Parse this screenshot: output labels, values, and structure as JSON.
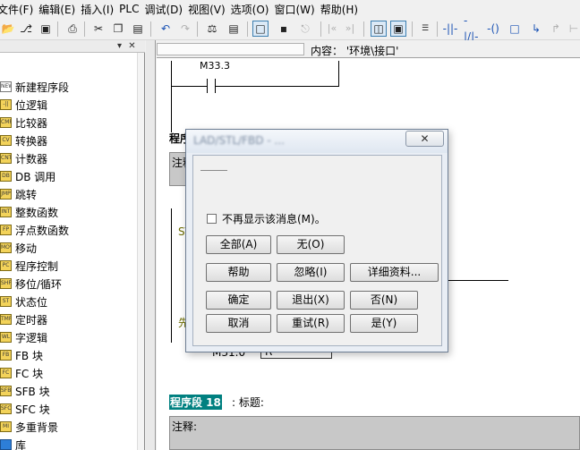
{
  "menubar": {
    "items": [
      "文件(F)",
      "编辑(E)",
      "插入(I)",
      "PLC",
      "调试(D)",
      "视图(V)",
      "选项(O)",
      "窗口(W)",
      "帮助(H)"
    ]
  },
  "toolbar": {
    "icons": [
      "open-folder-icon",
      "save-icon",
      "print-icon",
      "cut-icon",
      "copy-icon",
      "paste-icon",
      "undo-icon",
      "redo-icon",
      "monitor-icon",
      "zoom-icon",
      "normally-open-contact-icon",
      "normally-closed-contact-icon",
      "coil-icon"
    ]
  },
  "left_panel": {
    "items": [
      {
        "label": "新建程序段",
        "icon": "new-network-icon"
      },
      {
        "label": "位逻辑",
        "icon": "bit-logic-icon"
      },
      {
        "label": "比较器",
        "icon": "comparator-icon"
      },
      {
        "label": "转换器",
        "icon": "converter-icon"
      },
      {
        "label": "计数器",
        "icon": "counter-icon"
      },
      {
        "label": "DB 调用",
        "icon": "db-call-icon"
      },
      {
        "label": "跳转",
        "icon": "jump-icon"
      },
      {
        "label": "整数函数",
        "icon": "integer-function-icon"
      },
      {
        "label": "浮点数函数",
        "icon": "float-function-icon"
      },
      {
        "label": "移动",
        "icon": "move-icon"
      },
      {
        "label": "程序控制",
        "icon": "program-control-icon"
      },
      {
        "label": "移位/循环",
        "icon": "shift-rotate-icon"
      },
      {
        "label": "状态位",
        "icon": "status-bit-icon"
      },
      {
        "label": "定时器",
        "icon": "timer-icon"
      },
      {
        "label": "字逻辑",
        "icon": "word-logic-icon"
      },
      {
        "label": "FB 块",
        "icon": "fb-block-icon"
      },
      {
        "label": "FC 块",
        "icon": "fc-block-icon"
      },
      {
        "label": "SFB 块",
        "icon": "sfb-block-icon"
      },
      {
        "label": "SFC 块",
        "icon": "sfc-block-icon"
      },
      {
        "label": "多重背景",
        "icon": "multi-instance-icon"
      },
      {
        "label": "库",
        "icon": "library-icon"
      }
    ]
  },
  "editor": {
    "content_label": "内容：  '环境\\接口'",
    "address_top": "M33.3",
    "network_partial": "程序",
    "comment_partial": "注释",
    "fragment_1": "ST",
    "fragment_2": "先",
    "fragment_3": "M31.0",
    "fragment_4": "R",
    "network_label": "程序段 18",
    "title_label": ": 标题:",
    "comment_label": "注释:"
  },
  "dialog": {
    "title": "LAD/STL/FBD - ...",
    "close_label": "✕",
    "checkbox_label": "不再显示该消息(M)。",
    "buttons": {
      "all": "全部(A)",
      "none": "无(O)",
      "help": "帮助",
      "ignore": "忽略(I)",
      "details": "详细资料...",
      "ok": "确定",
      "exit": "退出(X)",
      "no": "否(N)",
      "cancel": "取消",
      "retry": "重试(R)",
      "yes": "是(Y)"
    }
  }
}
